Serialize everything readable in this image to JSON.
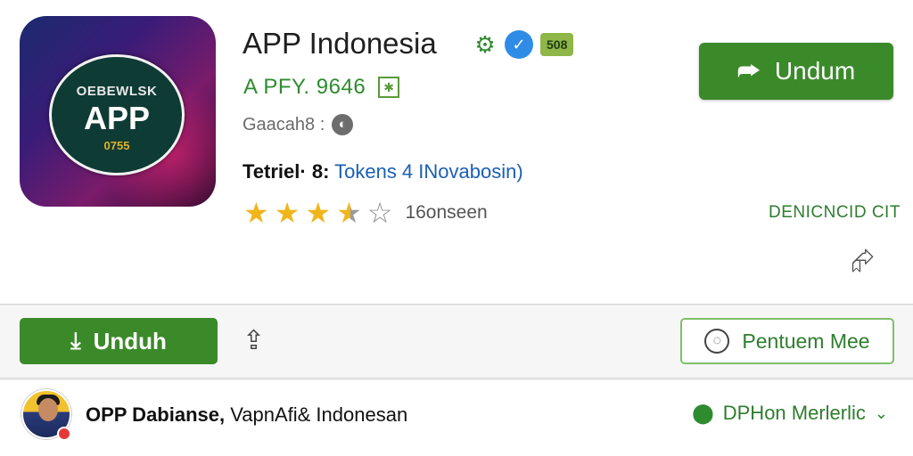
{
  "app": {
    "icon": {
      "top_text": "OEBEWLSK",
      "main_text": "APP",
      "sub_text": "0755"
    },
    "title": "APP Indonesia",
    "badges": {
      "gear_icon": "gear-icon",
      "verified_icon": "verified-icon",
      "number": "508"
    },
    "developer": "A PFY. 9646",
    "category": "Gaacah8 :",
    "info_label": "Tetriel· 8:",
    "info_link": "Tokens  4 INovabosin)",
    "rating": {
      "value": 3.5,
      "max": 5,
      "count_text": "16onseen"
    },
    "download_label_top": "Undum",
    "tag_text": "DENICNCID CIT"
  },
  "action_bar": {
    "download_label": "Unduh",
    "secondary_label": "Pentuem Mee"
  },
  "footer": {
    "publisher_bold": "OPP Dabianse,",
    "publisher_rest": " VapnAfi& Indonesan",
    "region": "DPHon Merlerlic"
  },
  "colors": {
    "accent_green": "#3b8a2a",
    "star": "#f1b51c",
    "link_blue": "#1a5fb4"
  }
}
